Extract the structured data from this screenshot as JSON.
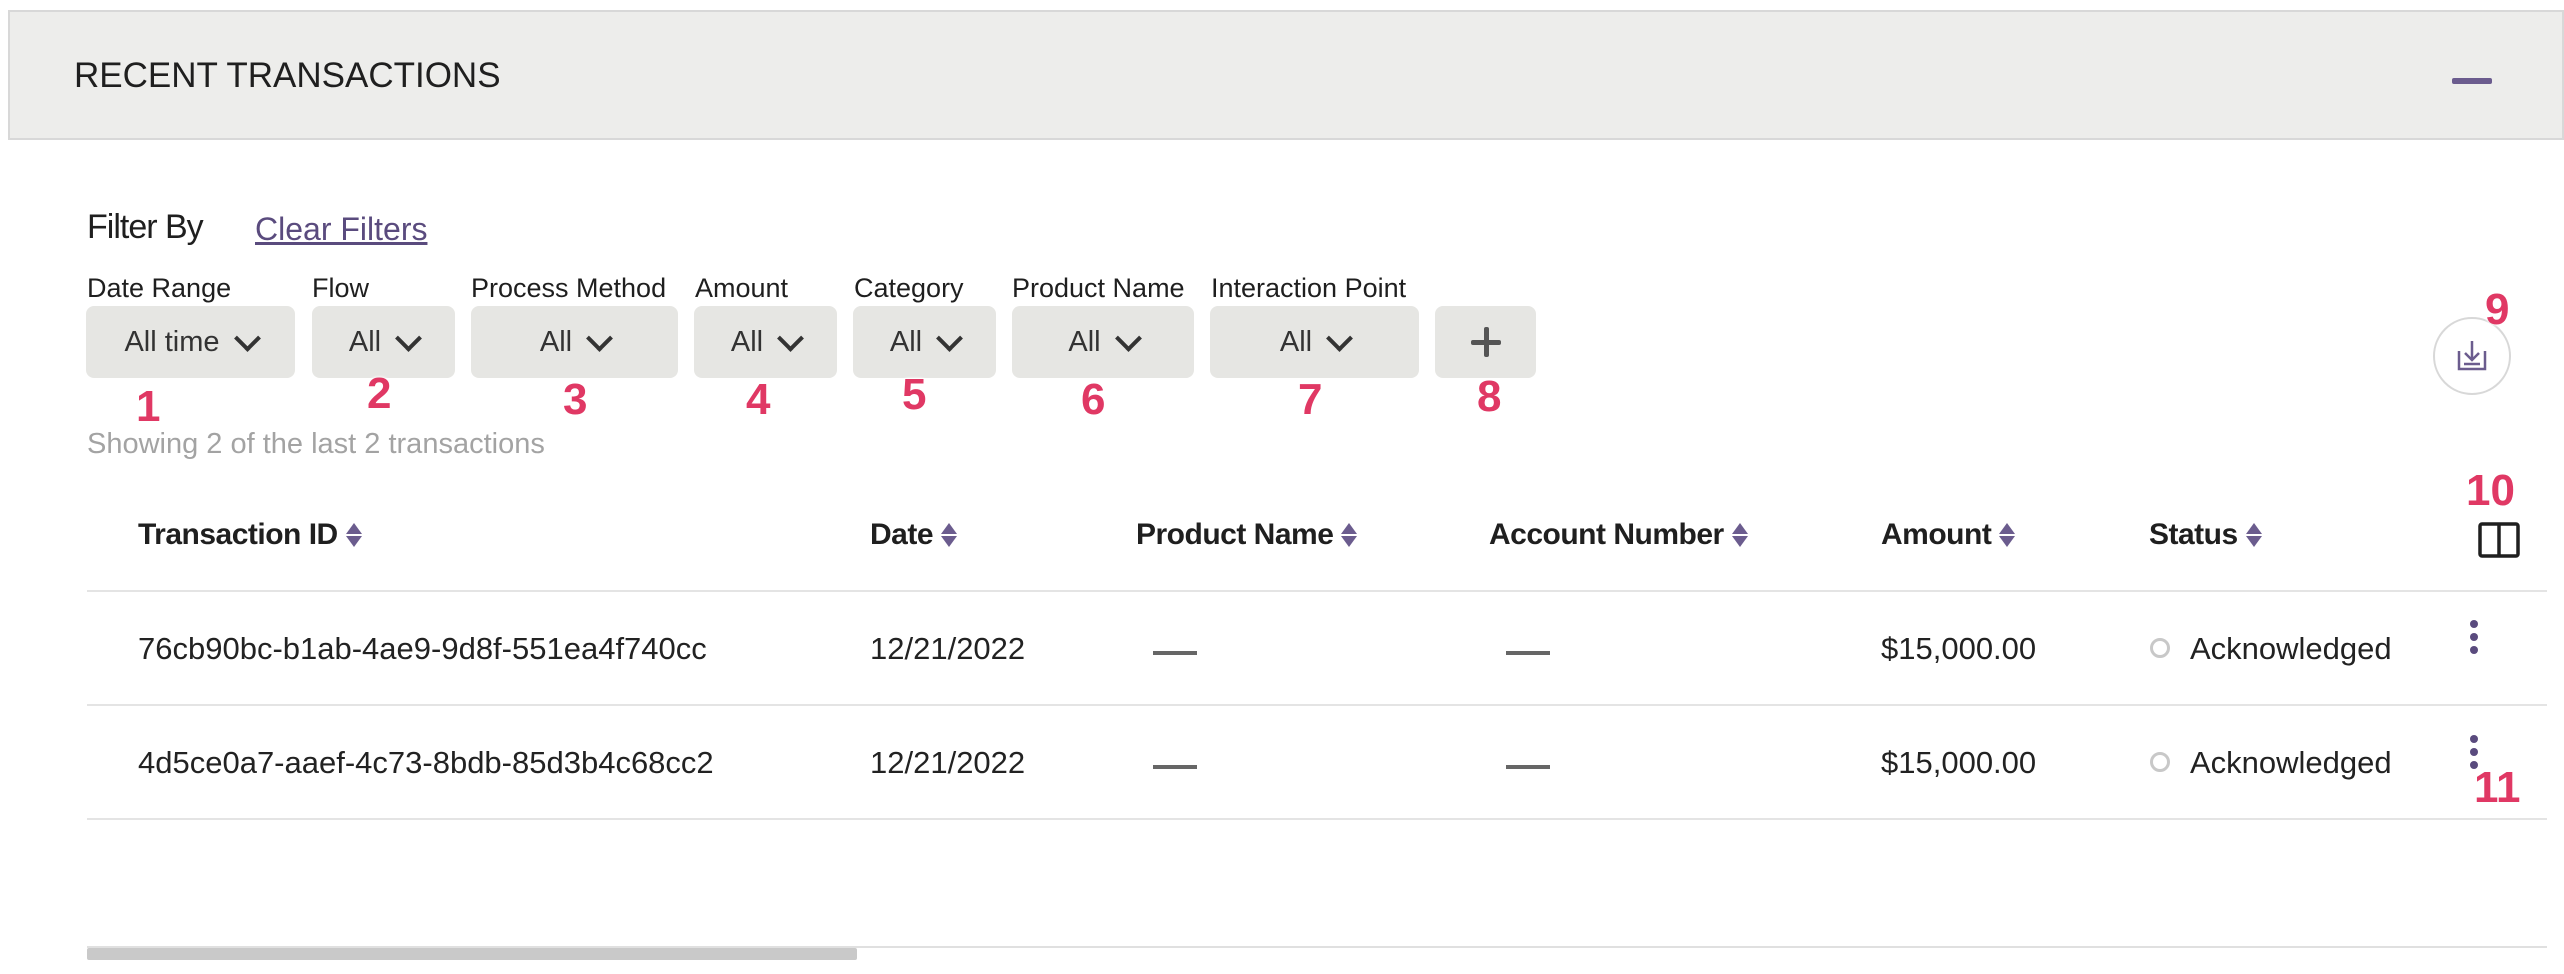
{
  "panel": {
    "title": "RECENT TRANSACTIONS"
  },
  "filters": {
    "heading": "Filter By",
    "clear_label": "Clear Filters",
    "items": [
      {
        "label": "Date Range",
        "value": "All time"
      },
      {
        "label": "Flow",
        "value": "All"
      },
      {
        "label": "Process Method",
        "value": "All"
      },
      {
        "label": "Amount",
        "value": "All"
      },
      {
        "label": "Category",
        "value": "All"
      },
      {
        "label": "Product Name",
        "value": "All"
      },
      {
        "label": "Interaction Point",
        "value": "All"
      }
    ]
  },
  "summary": "Showing 2 of the last 2 transactions",
  "table": {
    "columns": [
      "Transaction ID",
      "Date",
      "Product Name",
      "Account Number",
      "Amount",
      "Status"
    ],
    "rows": [
      {
        "id": "76cb90bc-b1ab-4ae9-9d8f-551ea4f740cc",
        "date": "12/21/2022",
        "amount": "$15,000.00",
        "status": "Acknowledged"
      },
      {
        "id": "4d5ce0a7-aaef-4c73-8bdb-85d3b4c68cc2",
        "date": "12/21/2022",
        "amount": "$15,000.00",
        "status": "Acknowledged"
      }
    ]
  },
  "markers": [
    "1",
    "2",
    "3",
    "4",
    "5",
    "6",
    "7",
    "8",
    "9",
    "10",
    "11"
  ],
  "icons": {
    "collapse": "minus-icon",
    "chevron": "chevron-down-icon",
    "add_filter": "plus-icon",
    "download": "download-icon",
    "columns": "columns-icon",
    "row_menu": "kebab-menu-icon",
    "sort": "sort-icon",
    "status": "status-circle-icon"
  },
  "colors": {
    "accent": "#6b5c8e",
    "marker": "#e03864",
    "header_bg": "#ededeb",
    "filter_bg": "#e6e6e3"
  }
}
